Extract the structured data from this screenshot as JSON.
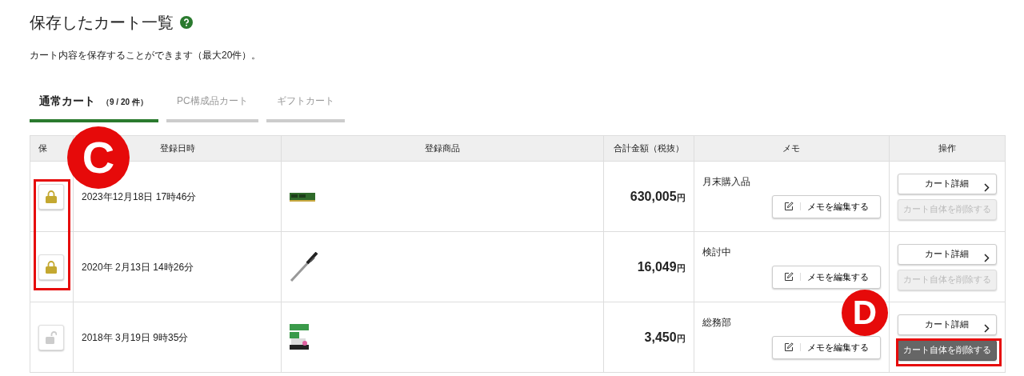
{
  "title": "保存したカート一覧",
  "description": "カート内容を保存することができます（最大20件）。",
  "tabs": [
    {
      "label": "通常カート",
      "count": "（9 / 20 件）",
      "selected": true
    },
    {
      "label": "PC構成品カート",
      "selected": false
    },
    {
      "label": "ギフトカート",
      "selected": false
    }
  ],
  "table": {
    "columns": [
      "保",
      "登録日時",
      "登録商品",
      "合計金額（税抜）",
      "メモ",
      "操作"
    ],
    "rows": [
      {
        "locked": true,
        "date": "2023年12月18日 17時46分",
        "amount": "630,005",
        "currency": "円",
        "memo": "月末購入品",
        "edit_button": "メモを編集する",
        "detail_button": "カート詳細",
        "delete_button": {
          "label": "カート自体を削除する",
          "disabled": true
        }
      },
      {
        "locked": true,
        "date": "2020年 2月13日 14時26分",
        "amount": "16,049",
        "currency": "円",
        "memo": "検討中",
        "edit_button": "メモを編集する",
        "detail_button": "カート詳細",
        "delete_button": {
          "label": "カート自体を削除する",
          "disabled": true
        }
      },
      {
        "locked": false,
        "date": "2018年 3月19日  9時35分",
        "amount": "3,450",
        "currency": "円",
        "memo": "総務部",
        "edit_button": "メモを編集する",
        "detail_button": "カート詳細",
        "delete_button": {
          "label": "カート自体を削除する",
          "disabled": false
        }
      }
    ]
  },
  "annotations": [
    {
      "label": "C"
    },
    {
      "label": "D"
    }
  ]
}
